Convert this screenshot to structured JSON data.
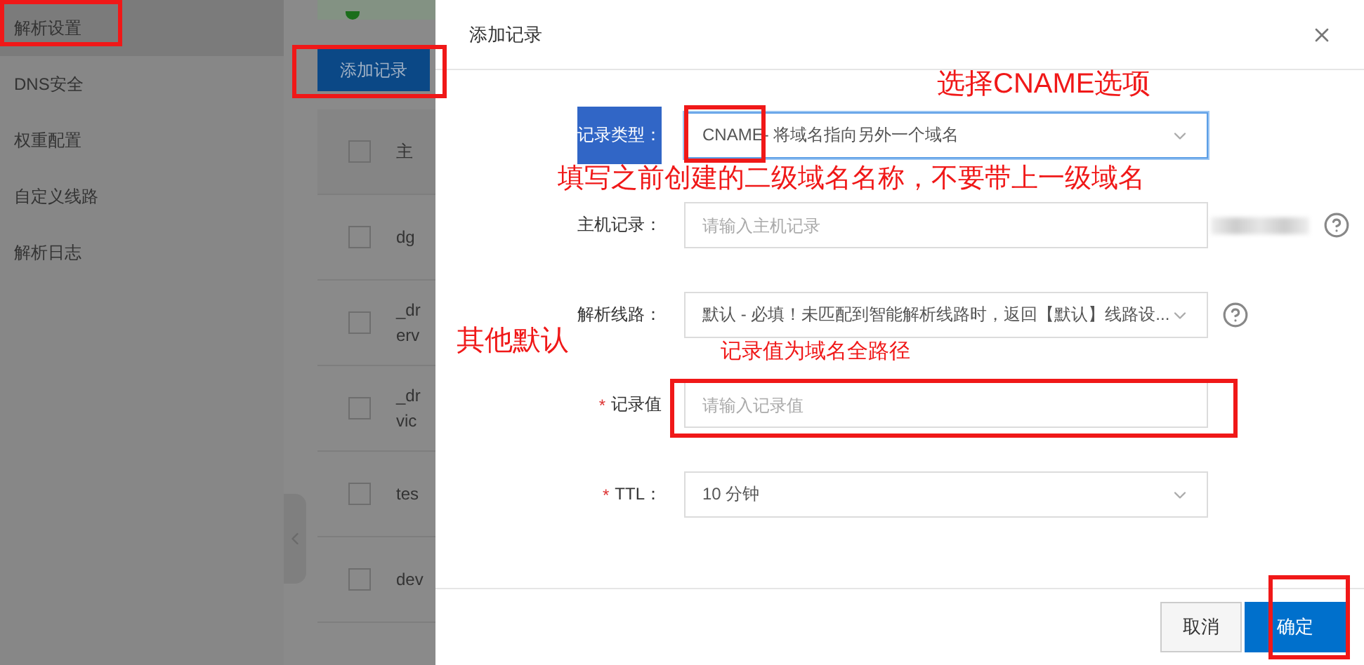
{
  "sidebar": {
    "items": [
      {
        "label": "解析设置",
        "selected": true
      },
      {
        "label": "DNS安全",
        "selected": false
      },
      {
        "label": "权重配置",
        "selected": false
      },
      {
        "label": "自定义线路",
        "selected": false
      },
      {
        "label": "解析日志",
        "selected": false
      }
    ]
  },
  "toolbar": {
    "add_button": "添加记录"
  },
  "table": {
    "header": "主",
    "header_checked": false,
    "rows": [
      {
        "cells": [
          "dg"
        ],
        "checked": false
      },
      {
        "cells": [
          "_dr",
          "erv"
        ],
        "checked": false
      },
      {
        "cells": [
          "_dr",
          "vic"
        ],
        "checked": false
      },
      {
        "cells": [
          "tes"
        ],
        "checked": false
      },
      {
        "cells": [
          "dev"
        ],
        "checked": false
      }
    ]
  },
  "dialog": {
    "title": "添加记录",
    "fields": [
      {
        "kind": "select",
        "label": "记录类型：",
        "label_highlighted": true,
        "value": "CNAME- 将域名指向另外一个域名",
        "focused": true,
        "help": false,
        "redacted": false
      },
      {
        "kind": "input",
        "label": "主机记录：",
        "label_highlighted": false,
        "placeholder": "请输入主机记录",
        "focused": false,
        "help": true,
        "redacted": true
      },
      {
        "kind": "select",
        "label": "解析线路：",
        "label_highlighted": false,
        "value": "默认 - 必填！未匹配到智能解析线路时，返回【默认】线路设...",
        "focused": false,
        "help": true,
        "redacted": false
      },
      {
        "kind": "input",
        "required_mark": "*",
        "label": "记录值",
        "label_highlighted": false,
        "placeholder": "请输入记录值",
        "focused": false,
        "help": false,
        "redacted": false
      },
      {
        "kind": "select",
        "required_mark": "*",
        "label": "TTL：",
        "label_highlighted": false,
        "value": "10 分钟",
        "focused": false,
        "help": false,
        "redacted": false
      }
    ],
    "buttons": [
      {
        "label": "取消",
        "kind": "secondary"
      },
      {
        "label": "确定",
        "kind": "primary"
      }
    ]
  },
  "annotations": [
    "选择CNAME选项",
    "填写之前创建的二级域名名称，不要带上一级域名",
    "其他默认",
    "记录值为域名全路径"
  ]
}
